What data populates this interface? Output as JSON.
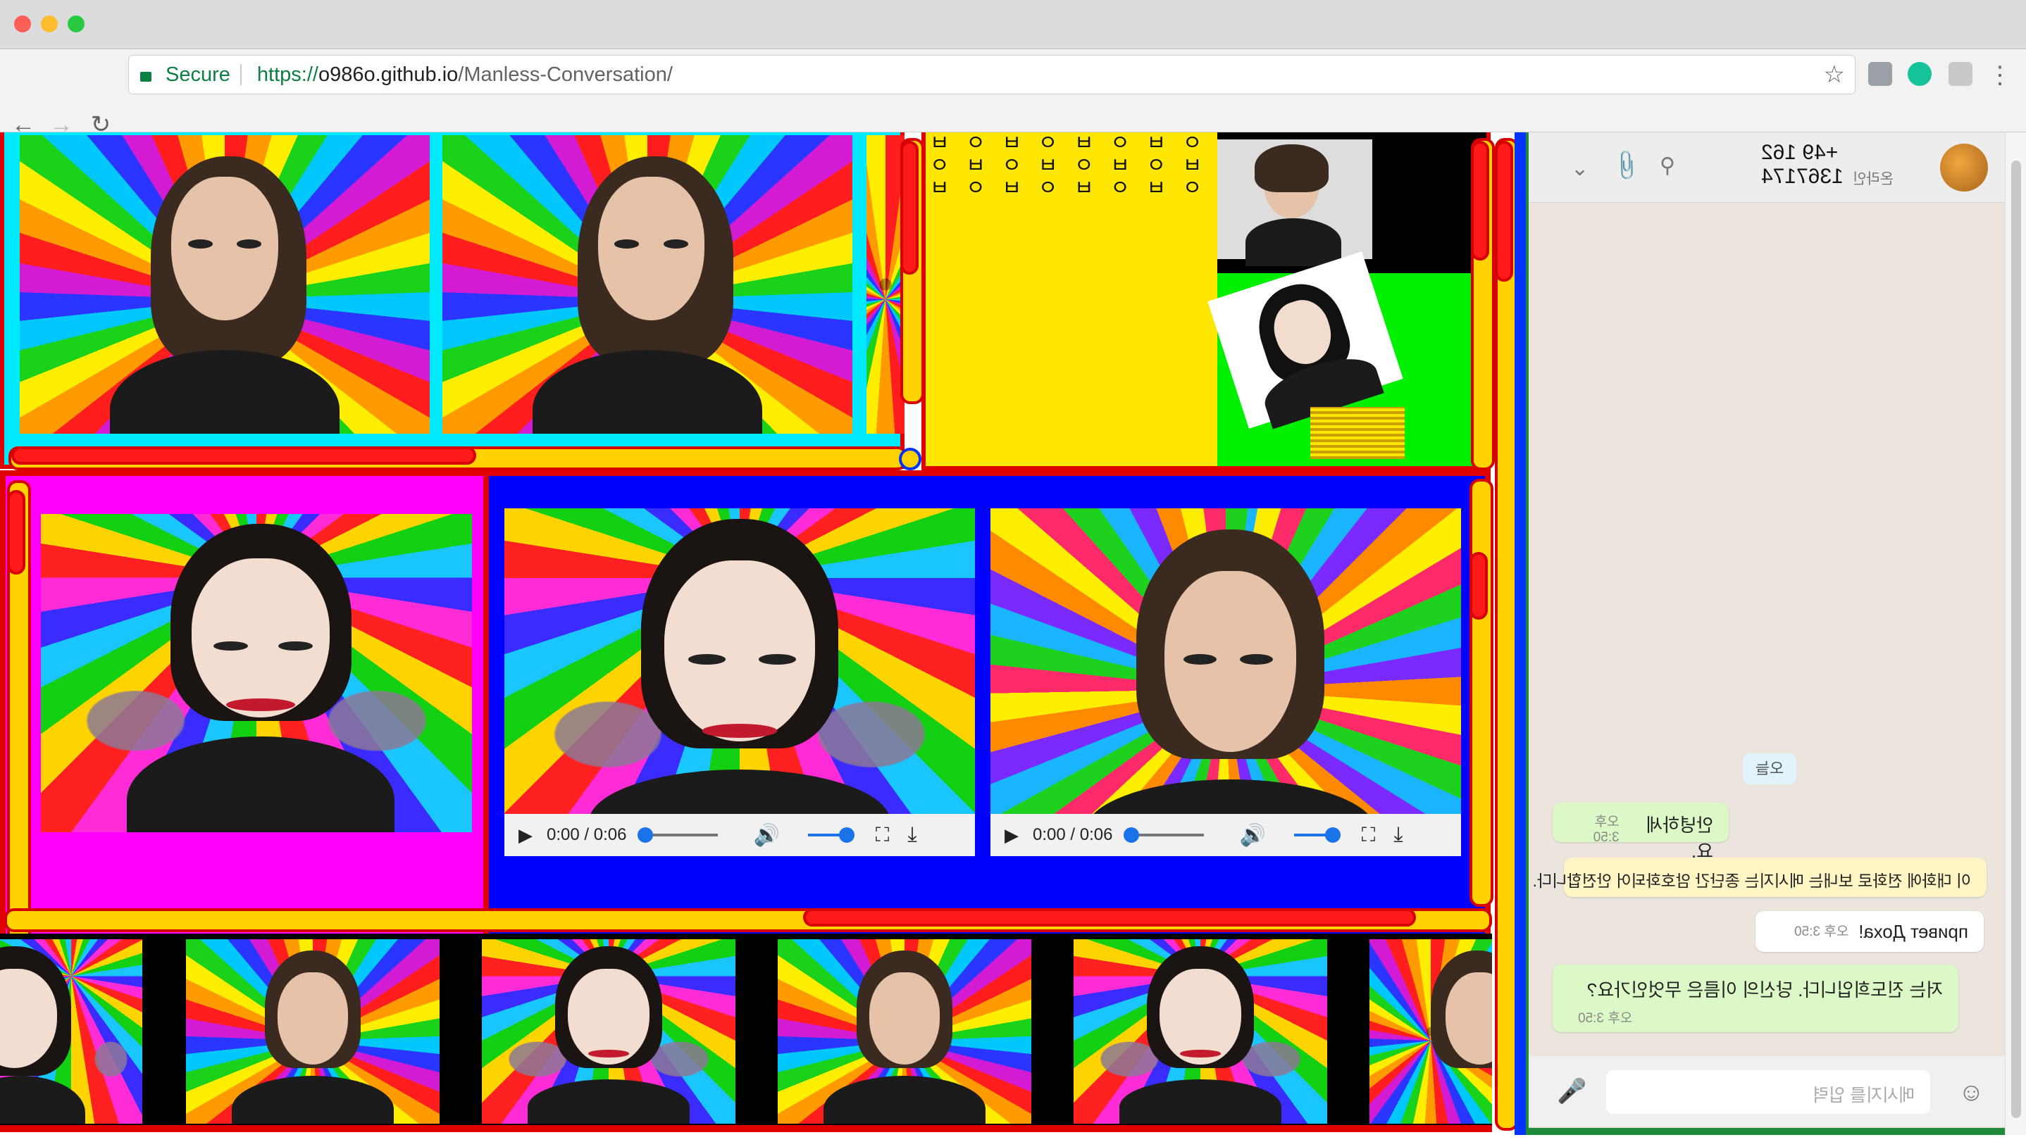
{
  "browser": {
    "secure_label": "Secure",
    "url_scheme": "https://",
    "url_host": "o986o.github.io",
    "url_path": "/Manless-Conversation/"
  },
  "videos": [
    {
      "time": "0:00 / 0:06"
    },
    {
      "time": "0:00 / 0:06"
    }
  ],
  "glyph_column_text": "ㅂ ㅇ ㅂ ㅇ ㅂ ㅇ ㅂ ㅇ ㅂ ㅇ ㅂ ㅇ ㅂ ㅇ ㅂ ㅇ ㅂ ㅇ ㅂ ㅇ ㅂ ㅇ ㅂ ㅇ",
  "chat": {
    "contact_name": "+49 162 1367174",
    "contact_status": "온라인",
    "date_chip": "오늘",
    "messages": [
      {
        "text": "안녕하세요.",
        "time": "오후 3:50",
        "side": "in"
      },
      {
        "text": "이 대화에 전화로 보내는 메시지는 종단간 암호화되어 안전합니다.",
        "time": "",
        "side": "system"
      },
      {
        "text": "привет Доха!",
        "time": "오후 3:50",
        "side": "out"
      },
      {
        "text": "저는 진도희입니다. 당신의 이름은 무엇인가요?",
        "time": "오후 3:50",
        "side": "in"
      }
    ],
    "input_placeholder": "메시지를 입력"
  },
  "colors": {
    "cyan_frame": "#00eaff",
    "magenta_frame": "#ff00ff",
    "blue_frame": "#0000ff",
    "red_border": "#e00000",
    "yellow": "#ffd200",
    "chat_bg": "#ece5dd",
    "chat_green": "#dcf8c6"
  }
}
